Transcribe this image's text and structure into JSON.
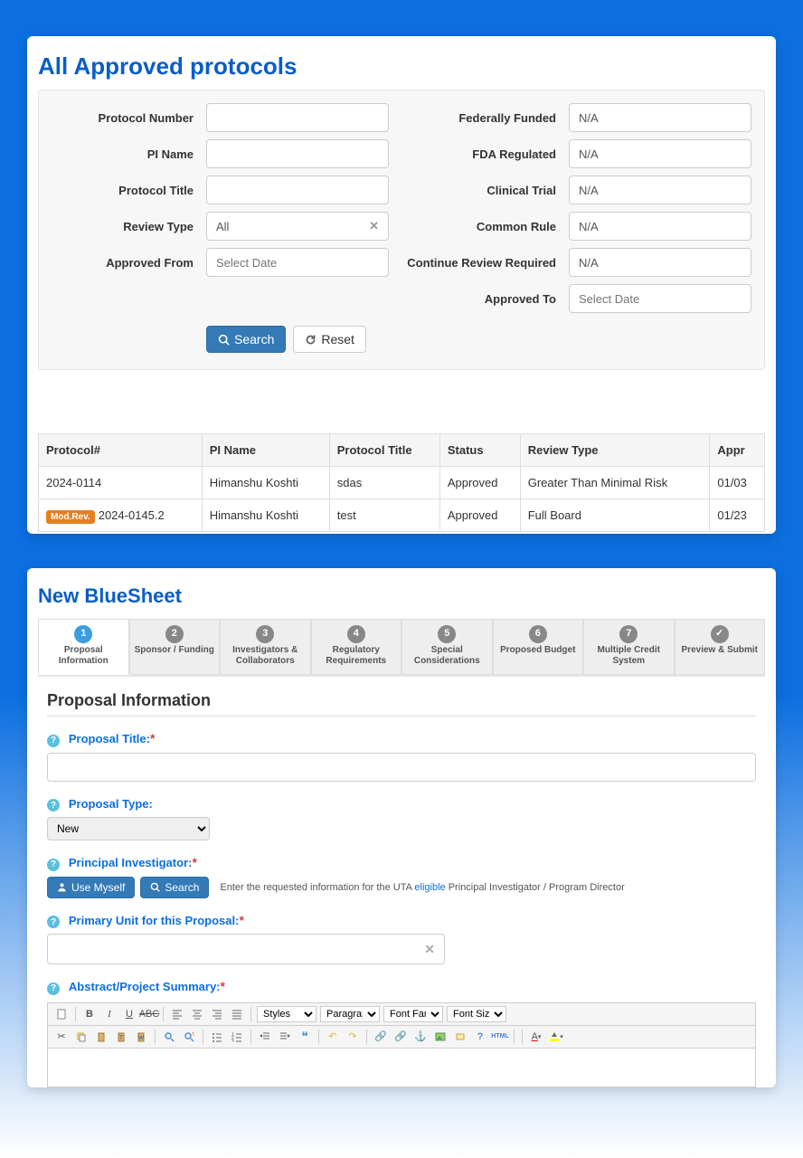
{
  "panel1": {
    "title": "All Approved protocols",
    "labels": {
      "protocol_number": "Protocol Number",
      "pi_name": "PI Name",
      "protocol_title": "Protocol Title",
      "review_type": "Review Type",
      "approved_from": "Approved From",
      "federally_funded": "Federally Funded",
      "fda_regulated": "FDA Regulated",
      "clinical_trial": "Clinical Trial",
      "common_rule": "Common Rule",
      "continue_review_required": "Continue Review Required",
      "approved_to": "Approved To"
    },
    "values": {
      "review_type": "All",
      "na": "N/A",
      "select_date": "Select Date"
    },
    "buttons": {
      "search": "Search",
      "reset": "Reset"
    },
    "table": {
      "headers": {
        "protocol": "Protocol#",
        "pi_name": "PI Name",
        "title": "Protocol Title",
        "status": "Status",
        "review_type": "Review Type",
        "approved": "Appr"
      },
      "rows": [
        {
          "badge": "",
          "protocol": "2024-0114",
          "pi": "Himanshu Koshti",
          "title": "sdas",
          "status": "Approved",
          "review": "Greater Than Minimal Risk",
          "approved": "01/03"
        },
        {
          "badge": "Mod.Rev.",
          "protocol": "2024-0145.2",
          "pi": "Himanshu Koshti",
          "title": "test",
          "status": "Approved",
          "review": "Full Board",
          "approved": "01/23"
        }
      ]
    }
  },
  "panel2": {
    "title": "New BlueSheet",
    "steps": [
      {
        "num": "1",
        "label": "Proposal Information"
      },
      {
        "num": "2",
        "label": "Sponsor / Funding"
      },
      {
        "num": "3",
        "label": "Investigators & Collaborators"
      },
      {
        "num": "4",
        "label": "Regulatory Requirements"
      },
      {
        "num": "5",
        "label": "Special Considerations"
      },
      {
        "num": "6",
        "label": "Proposed Budget"
      },
      {
        "num": "7",
        "label": "Multiple Credit System"
      },
      {
        "num": "✓",
        "label": "Preview & Submit"
      }
    ],
    "section": "Proposal Information",
    "fields": {
      "proposal_title": "Proposal Title:",
      "proposal_type": "Proposal Type:",
      "proposal_type_value": "New",
      "principal_investigator": "Principal Investigator:",
      "use_myself": "Use Myself",
      "search": "Search",
      "pi_note_pre": "Enter the requested information for the UTA ",
      "pi_note_link": "eligible",
      "pi_note_post": " Principal Investigator / Program Director",
      "primary_unit": "Primary Unit for this Proposal:",
      "abstract": "Abstract/Project Summary:"
    },
    "editor": {
      "styles": "Styles",
      "paragraph": "Paragraph",
      "font_family": "Font Family",
      "font_size": "Font Size"
    }
  }
}
